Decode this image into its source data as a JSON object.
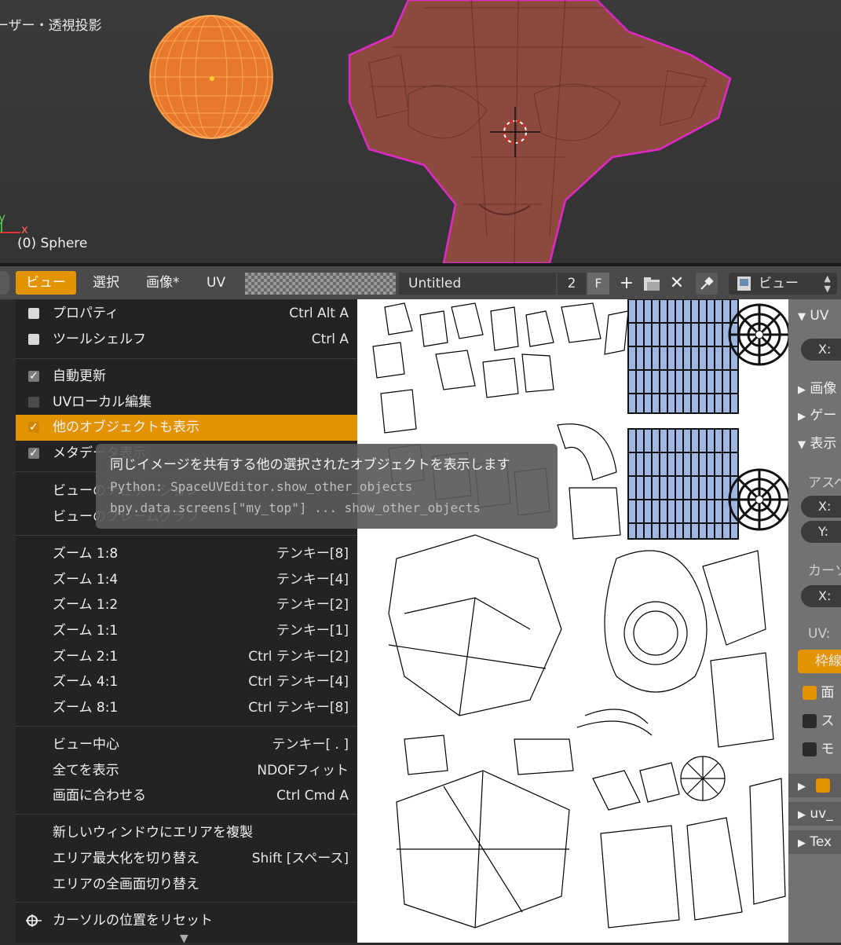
{
  "viewport": {
    "title": "ーザー・透視投影",
    "object_label": "(0) Sphere",
    "axis_y": "y",
    "axis_x": "x"
  },
  "header": {
    "menus": [
      "ビュー",
      "選択",
      "画像*",
      "UV"
    ],
    "image_name": "Untitled",
    "image_users": "2",
    "fake_user": "F",
    "view_mode": "ビュー"
  },
  "menu": {
    "items": [
      {
        "label": "プロパティ",
        "shortcut": "Ctrl Alt A"
      },
      {
        "label": "ツールシェルフ",
        "shortcut": "Ctrl A"
      },
      {
        "label": "自動更新",
        "shortcut": ""
      },
      {
        "label": "UVローカル編集",
        "shortcut": ""
      },
      {
        "label": "他のオブジェクトも表示",
        "shortcut": ""
      },
      {
        "label": "メタデータ表示",
        "shortcut": ""
      },
      {
        "label": "ビューのナビゲーション",
        "shortcut": ""
      },
      {
        "label": "ビューのフレームグラフ",
        "shortcut": ""
      },
      {
        "label": "ズーム 1:8",
        "shortcut": "テンキー[8]"
      },
      {
        "label": "ズーム 1:4",
        "shortcut": "テンキー[4]"
      },
      {
        "label": "ズーム 1:2",
        "shortcut": "テンキー[2]"
      },
      {
        "label": "ズーム 1:1",
        "shortcut": "テンキー[1]"
      },
      {
        "label": "ズーム 2:1",
        "shortcut": "Ctrl テンキー[2]"
      },
      {
        "label": "ズーム 4:1",
        "shortcut": "Ctrl テンキー[4]"
      },
      {
        "label": "ズーム 8:1",
        "shortcut": "Ctrl テンキー[8]"
      },
      {
        "label": "ビュー中心",
        "shortcut": "テンキー[ . ]"
      },
      {
        "label": "全てを表示",
        "shortcut": "NDOFフィット"
      },
      {
        "label": "画面に合わせる",
        "shortcut": "Ctrl Cmd A"
      },
      {
        "label": "新しいウィンドウにエリアを複製",
        "shortcut": ""
      },
      {
        "label": "エリア最大化を切り替え",
        "shortcut": "Shift [スペース]"
      },
      {
        "label": "エリアの全画面切り替え",
        "shortcut": ""
      },
      {
        "label": "カーソルの位置をリセット",
        "shortcut": ""
      }
    ]
  },
  "tooltip": {
    "description": "同じイメージを共有する他の選択されたオブジェクトを表示します",
    "python": "Python: SpaceUVEditor.show_other_objects",
    "path": "bpy.data.screens[\"my_top\"] ... show_other_objects"
  },
  "sidebar": {
    "panel_uv": "UV",
    "x_label": "X:",
    "panel_image": "画像",
    "panel_game": "ゲー",
    "panel_display": "表示",
    "aspect_label": "アスペ",
    "aspect_x": "X:",
    "aspect_y": "Y:",
    "cursor_label": "カーソ",
    "cursor_x": "X:",
    "uv_label": "UV:",
    "outline_btn": "枠線",
    "opt1": "面",
    "opt2": "ス",
    "opt3": "モ",
    "uv_name": "uv_",
    "tex_name": "Tex"
  },
  "colors": {
    "accent": "#e39200",
    "sphere": "#e8782a",
    "monkey": "#8c4a3e",
    "outline": "#e028c8"
  }
}
